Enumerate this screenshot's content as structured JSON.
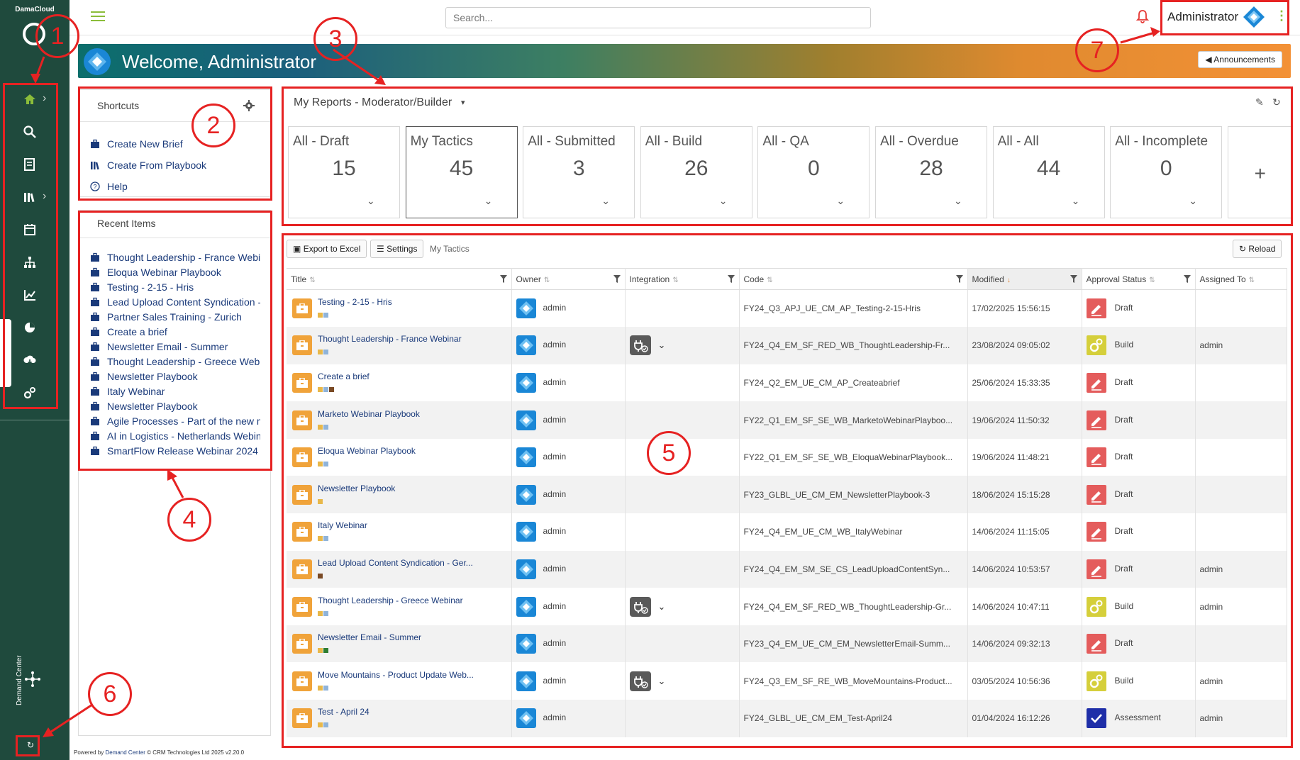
{
  "app": {
    "brand": "DamaCloud",
    "footer": {
      "prefix": "Powered by ",
      "link": "Demand Center",
      "suffix": " © CRM Technologies Ltd 2025 v2.20.0"
    }
  },
  "topbar": {
    "search_placeholder": "Search...",
    "user_name": "Administrator",
    "menu_glyph": "⋮"
  },
  "sidebar": {
    "bottom_label": "Demand Center",
    "collapse_glyph": "↻"
  },
  "banner": {
    "title": "Welcome, Administrator",
    "announcements_label": "Announcements"
  },
  "shortcuts": {
    "title": "Shortcuts",
    "items": [
      "Create New Brief",
      "Create From Playbook",
      "Help"
    ]
  },
  "recent": {
    "title": "Recent Items",
    "items": [
      "Thought Leadership - France Webinar",
      "Eloqua Webinar Playbook",
      "Testing - 2-15 - Hris",
      "Lead Upload Content Syndication - Germany",
      "Partner Sales Training - Zurich",
      "Create a brief",
      "Newsletter Email - Summer",
      "Thought Leadership - Greece Webinar",
      "Newsletter Playbook",
      "Italy Webinar",
      "Newsletter Playbook",
      "Agile Processes - Part of the new marketing",
      "AI in Logistics - Netherlands Webinar",
      "SmartFlow Release Webinar 2024"
    ]
  },
  "reports": {
    "title": "My Reports - Moderator/Builder",
    "caret": "▾",
    "tiles": [
      {
        "label": "All - Draft",
        "count": "15"
      },
      {
        "label": "My Tactics",
        "count": "45"
      },
      {
        "label": "All - Submitted",
        "count": "3"
      },
      {
        "label": "All - Build",
        "count": "26"
      },
      {
        "label": "All - QA",
        "count": "0"
      },
      {
        "label": "All - Overdue",
        "count": "28"
      },
      {
        "label": "All - All",
        "count": "44"
      },
      {
        "label": "All - Incomplete",
        "count": "0"
      }
    ],
    "add_label": "+",
    "edit_glyph": "✎",
    "refresh_glyph": "↻"
  },
  "grid": {
    "export_label": "Export to Excel",
    "settings_label": "Settings",
    "view_label": "My Tactics",
    "reload_label": "Reload",
    "columns": [
      "Title",
      "Owner",
      "Integration",
      "Code",
      "Modified",
      "Approval Status",
      "Assigned To"
    ],
    "rows": [
      {
        "title": "Testing - 2-15 - Hris",
        "owner": "admin",
        "integration": false,
        "code": "FY24_Q3_APJ_UE_CM_AP_Testing-2-15-Hris",
        "modified": "17/02/2025 15:56:15",
        "status": "Draft",
        "assigned": "",
        "squares": [
          "#e8b84a",
          "#8fb3d9"
        ]
      },
      {
        "title": "Thought Leadership - France Webinar",
        "owner": "admin",
        "integration": true,
        "code": "FY24_Q4_EM_SF_RED_WB_ThoughtLeadership-Fr...",
        "modified": "23/08/2024 09:05:02",
        "status": "Build",
        "assigned": "admin",
        "squares": [
          "#e8b84a",
          "#8fb3d9"
        ]
      },
      {
        "title": "Create a brief",
        "owner": "admin",
        "integration": false,
        "code": "FY24_Q2_EM_UE_CM_AP_Createabrief",
        "modified": "25/06/2024 15:33:35",
        "status": "Draft",
        "assigned": "",
        "squares": [
          "#e8b84a",
          "#8fb3d9",
          "#7a4a25"
        ]
      },
      {
        "title": "Marketo Webinar Playbook",
        "owner": "admin",
        "integration": false,
        "code": "FY22_Q1_EM_SF_SE_WB_MarketoWebinarPlaybоо...",
        "modified": "19/06/2024 11:50:32",
        "status": "Draft",
        "assigned": "",
        "squares": [
          "#e8b84a",
          "#8fb3d9"
        ]
      },
      {
        "title": "Eloqua Webinar Playbook",
        "owner": "admin",
        "integration": false,
        "code": "FY22_Q1_EM_SF_SE_WB_EloquaWebinarPlaybook...",
        "modified": "19/06/2024 11:48:21",
        "status": "Draft",
        "assigned": "",
        "squares": [
          "#e8b84a",
          "#8fb3d9"
        ]
      },
      {
        "title": "Newsletter Playbook",
        "owner": "admin",
        "integration": false,
        "code": "FY23_GLBL_UE_CM_EM_NewsletterPlaybook-3",
        "modified": "18/06/2024 15:15:28",
        "status": "Draft",
        "assigned": "",
        "squares": [
          "#e8b84a"
        ]
      },
      {
        "title": "Italy Webinar",
        "owner": "admin",
        "integration": false,
        "code": "FY24_Q4_EM_UE_CM_WB_ItalyWebinar",
        "modified": "14/06/2024 11:15:05",
        "status": "Draft",
        "assigned": "",
        "squares": [
          "#e8b84a",
          "#8fb3d9"
        ]
      },
      {
        "title": "Lead Upload Content Syndication - Ger...",
        "owner": "admin",
        "integration": false,
        "code": "FY24_Q4_EM_SM_SE_CS_LeadUploadContentSyn...",
        "modified": "14/06/2024 10:53:57",
        "status": "Draft",
        "assigned": "admin",
        "squares": [
          "#7a4a25"
        ]
      },
      {
        "title": "Thought Leadership - Greece Webinar",
        "owner": "admin",
        "integration": true,
        "code": "FY24_Q4_EM_SF_RED_WB_ThoughtLeadership-Gr...",
        "modified": "14/06/2024 10:47:11",
        "status": "Build",
        "assigned": "admin",
        "squares": [
          "#e8b84a",
          "#8fb3d9"
        ]
      },
      {
        "title": "Newsletter Email - Summer",
        "owner": "admin",
        "integration": false,
        "code": "FY23_Q4_EM_UE_CM_EM_NewsletterEmail-Summ...",
        "modified": "14/06/2024 09:32:13",
        "status": "Draft",
        "assigned": "",
        "squares": [
          "#e8b84a",
          "#2e7d32"
        ]
      },
      {
        "title": "Move Mountains - Product Update Web...",
        "owner": "admin",
        "integration": true,
        "code": "FY24_Q3_EM_SF_RE_WB_MoveMountains-Product...",
        "modified": "03/05/2024 10:56:36",
        "status": "Build",
        "assigned": "admin",
        "squares": [
          "#e8b84a",
          "#8fb3d9"
        ]
      },
      {
        "title": "Test - April 24",
        "owner": "admin",
        "integration": false,
        "code": "FY24_GLBL_UE_CM_EM_Test-April24",
        "modified": "01/04/2024 16:12:26",
        "status": "Assessment",
        "assigned": "admin",
        "squares": [
          "#e8b84a",
          "#8fb3d9"
        ]
      }
    ]
  },
  "annotations": [
    "1",
    "2",
    "3",
    "4",
    "5",
    "6",
    "7"
  ],
  "colors": {
    "annotation": "#e62222",
    "sidebar": "#1f4a3d",
    "accent": "#8bbd3a",
    "draft": "#e45c5c",
    "build": "#d5cf3b",
    "assessment": "#1e2ea8"
  }
}
